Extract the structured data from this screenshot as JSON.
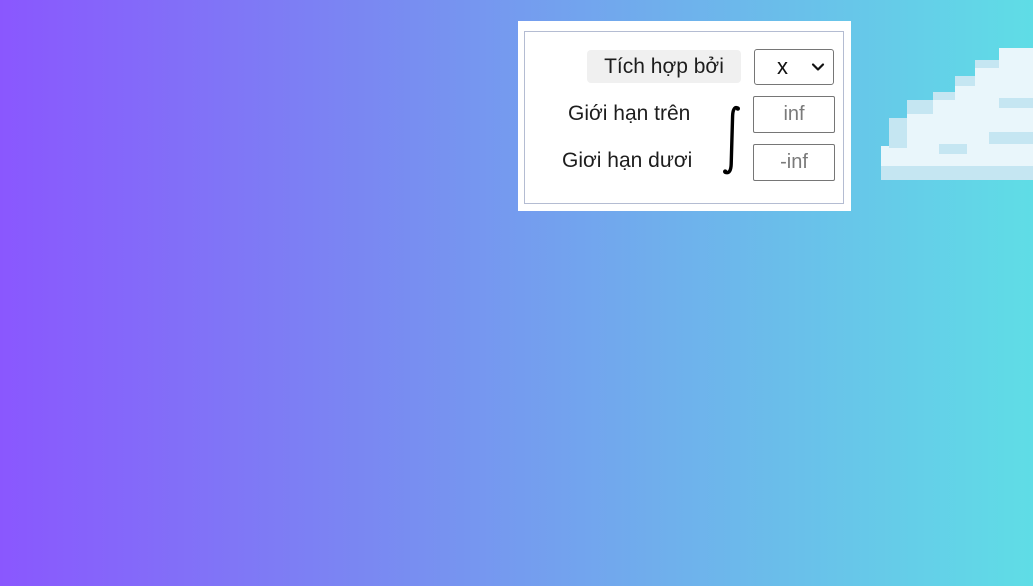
{
  "integration": {
    "integrate_by_label": "Tích hợp bởi",
    "variable_selected": "x",
    "upper_limit_label": "Giới hạn trên",
    "upper_limit_placeholder": "inf",
    "lower_limit_label": "Giơi hạn dươi",
    "lower_limit_placeholder": "-inf",
    "integral_symbol": "∫"
  },
  "icons": {
    "select_arrow": "chevron-down-icon",
    "integral": "integral-icon",
    "decoration": "cloud-icon"
  },
  "colors": {
    "gradient_start": "#8a57fe",
    "gradient_end": "#5fdde6",
    "panel_background": "#ffffff",
    "panel_border": "#b4bcd2",
    "cloud_fill": "#e9f6fb",
    "cloud_shadow": "#c5e6f2"
  }
}
